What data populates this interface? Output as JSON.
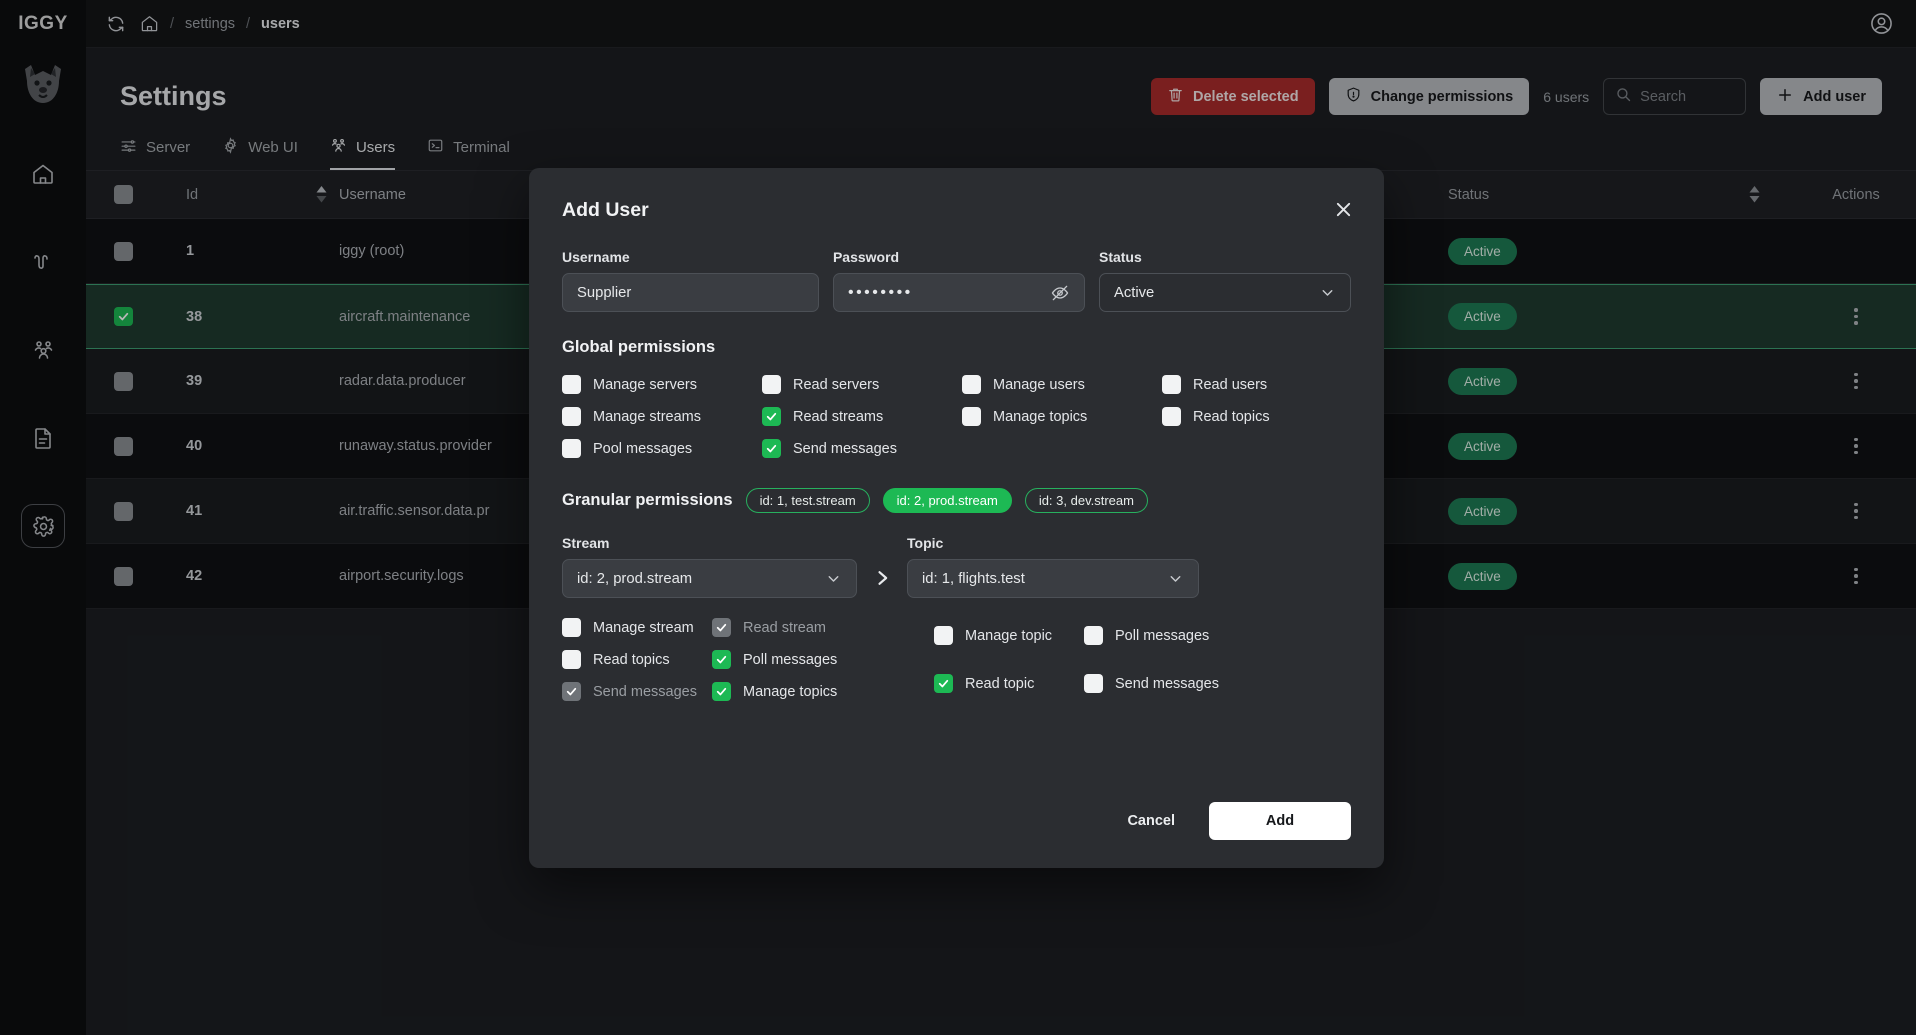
{
  "brand": "IGGY",
  "breadcrumb": {
    "root": "settings",
    "current": "users",
    "separator": "/"
  },
  "page": {
    "title": "Settings"
  },
  "toolbar": {
    "delete_selected": "Delete selected",
    "change_permissions": "Change permissions",
    "users_count": "6 users",
    "search_placeholder": "Search",
    "search_value": "",
    "add_user": "Add user"
  },
  "tabs": [
    {
      "label": "Server",
      "icon": "sliders-icon",
      "active": false
    },
    {
      "label": "Web UI",
      "icon": "gear-icon",
      "active": false
    },
    {
      "label": "Users",
      "icon": "users-icon",
      "active": true
    },
    {
      "label": "Terminal",
      "icon": "terminal-icon",
      "active": false
    }
  ],
  "table": {
    "columns": {
      "id": "Id",
      "username": "Username",
      "status": "Status",
      "actions": "Actions"
    },
    "rows": [
      {
        "id": "1",
        "username": "iggy (root)",
        "status": "Active",
        "checked": false,
        "selected": false,
        "has_actions": false
      },
      {
        "id": "38",
        "username": "aircraft.maintenance",
        "status": "Active",
        "checked": true,
        "selected": true,
        "has_actions": true
      },
      {
        "id": "39",
        "username": "radar.data.producer",
        "status": "Active",
        "checked": false,
        "selected": false,
        "has_actions": true
      },
      {
        "id": "40",
        "username": "runaway.status.provider",
        "status": "Active",
        "checked": false,
        "selected": false,
        "has_actions": true
      },
      {
        "id": "41",
        "username": "air.traffic.sensor.data.pr",
        "status": "Active",
        "checked": false,
        "selected": false,
        "has_actions": true
      },
      {
        "id": "42",
        "username": "airport.security.logs",
        "status": "Active",
        "checked": false,
        "selected": false,
        "has_actions": true
      }
    ]
  },
  "modal": {
    "title": "Add User",
    "username": {
      "label": "Username",
      "value": "Supplier"
    },
    "password": {
      "label": "Password",
      "value": "••••••••"
    },
    "status": {
      "label": "Status",
      "value": "Active"
    },
    "global_permissions": {
      "title": "Global permissions",
      "items": [
        {
          "label": "Manage servers",
          "checked": false,
          "disabled": false
        },
        {
          "label": "Read servers",
          "checked": false,
          "disabled": false
        },
        {
          "label": "Manage users",
          "checked": false,
          "disabled": false
        },
        {
          "label": "Read users",
          "checked": false,
          "disabled": false
        },
        {
          "label": "Manage streams",
          "checked": false,
          "disabled": false
        },
        {
          "label": "Read streams",
          "checked": true,
          "disabled": false
        },
        {
          "label": "Manage topics",
          "checked": false,
          "disabled": false
        },
        {
          "label": "Read topics",
          "checked": false,
          "disabled": false
        },
        {
          "label": "Pool messages",
          "checked": false,
          "disabled": false
        },
        {
          "label": "Send messages",
          "checked": true,
          "disabled": false
        }
      ]
    },
    "granular_permissions": {
      "title": "Granular permissions",
      "chips": [
        {
          "label": "id: 1, test.stream",
          "active": false
        },
        {
          "label": "id: 2, prod.stream",
          "active": true
        },
        {
          "label": "id: 3, dev.stream",
          "active": false
        }
      ],
      "stream": {
        "label": "Stream",
        "value": "id: 2, prod.stream"
      },
      "topic": {
        "label": "Topic",
        "value": "id: 1, flights.test"
      },
      "stream_items": [
        {
          "label": "Manage stream",
          "checked": false,
          "disabled": false
        },
        {
          "label": "Read stream",
          "checked": true,
          "disabled": true
        },
        {
          "label": "Read topics",
          "checked": false,
          "disabled": false
        },
        {
          "label": "Poll messages",
          "checked": true,
          "disabled": false
        },
        {
          "label": "Send messages",
          "checked": true,
          "disabled": true
        },
        {
          "label": "Manage topics",
          "checked": true,
          "disabled": false
        }
      ],
      "topic_items": [
        {
          "label": "Manage topic",
          "checked": false,
          "disabled": false
        },
        {
          "label": "Poll messages",
          "checked": false,
          "disabled": false
        },
        {
          "label": "Read topic",
          "checked": true,
          "disabled": false
        },
        {
          "label": "Send messages",
          "checked": false,
          "disabled": false
        }
      ]
    },
    "cancel": "Cancel",
    "submit": "Add"
  },
  "colors": {
    "accent_green": "#1db954",
    "danger_red": "#a92c2c",
    "status_badge": "#1e7a54",
    "modal_bg": "#2b2d31",
    "page_bg": "#1c1e22"
  }
}
